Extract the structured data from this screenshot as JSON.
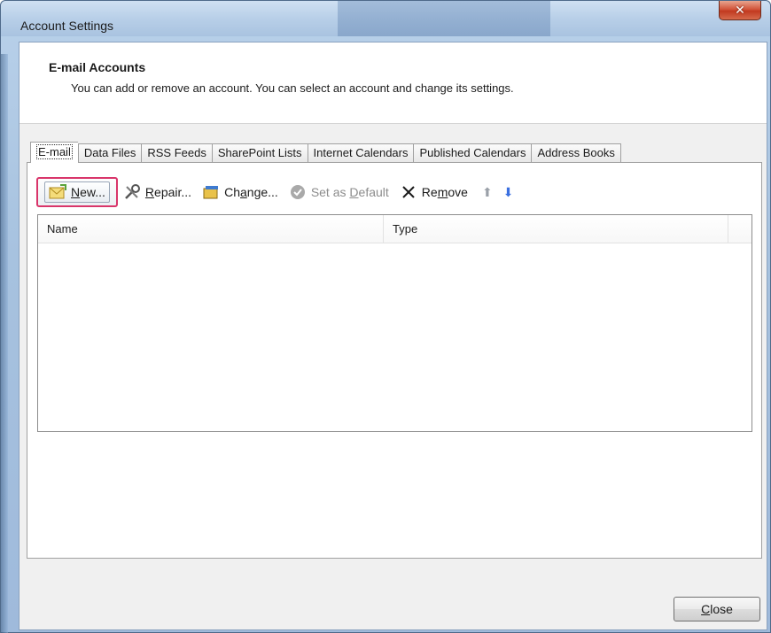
{
  "window": {
    "title": "Account Settings",
    "close_glyph": "✕"
  },
  "header": {
    "title": "E-mail Accounts",
    "description": "You can add or remove an account. You can select an account and change its settings."
  },
  "tabs": [
    {
      "label": "E-mail",
      "active": true
    },
    {
      "label": "Data Files"
    },
    {
      "label": "RSS Feeds"
    },
    {
      "label": "SharePoint Lists"
    },
    {
      "label": "Internet Calendars"
    },
    {
      "label": "Published Calendars"
    },
    {
      "label": "Address Books"
    }
  ],
  "toolbar": {
    "new": {
      "pre": "",
      "key": "N",
      "post": "ew..."
    },
    "repair": {
      "pre": "",
      "key": "R",
      "post": "epair..."
    },
    "change": {
      "pre": "Ch",
      "key": "a",
      "post": "nge..."
    },
    "set_default": {
      "pre": "Set as ",
      "key": "D",
      "post": "efault"
    },
    "remove": {
      "pre": "Re",
      "key": "m",
      "post": "ove"
    },
    "up_glyph": "⬆",
    "down_glyph": "⬇"
  },
  "list": {
    "columns": [
      "Name",
      "Type",
      ""
    ],
    "rows": []
  },
  "footer": {
    "close": {
      "key": "C",
      "post": "lose"
    }
  },
  "colors": {
    "highlight": "#d9356a",
    "down_arrow": "#3a6fe0",
    "up_arrow": "#9aa0a8"
  }
}
